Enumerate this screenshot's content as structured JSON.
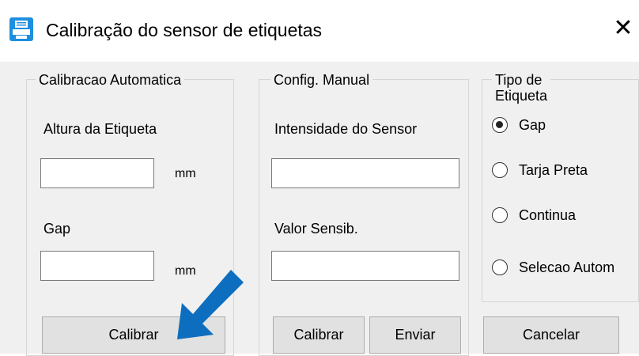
{
  "window": {
    "title": "Calibração do sensor de etiquetas",
    "app_icon": "printer-icon",
    "close_glyph": "✕",
    "accent_color": "#0f7fd0"
  },
  "auto_group": {
    "legend": "Calibracao Automatica",
    "height_label": "Altura da Etiqueta",
    "height_value": "",
    "height_unit": "mm",
    "gap_label": "Gap",
    "gap_value": "",
    "gap_unit": "mm",
    "calibrate_button": "Calibrar"
  },
  "manual_group": {
    "legend": "Config. Manual",
    "intensity_label": "Intensidade do Sensor",
    "intensity_value": "",
    "sensitivity_label": "Valor Sensib.",
    "sensitivity_value": "",
    "calibrate_button": "Calibrar",
    "send_button": "Enviar"
  },
  "type_group": {
    "legend_line1": "Tipo de",
    "legend_line2": "Etiqueta",
    "options": [
      {
        "label": "Gap",
        "checked": true
      },
      {
        "label": "Tarja Preta",
        "checked": false
      },
      {
        "label": "Continua",
        "checked": false
      },
      {
        "label": "Selecao Autom",
        "checked": false
      }
    ]
  },
  "cancel_button": "Cancelar",
  "overlay": {
    "arrow_icon": "pointer-arrow-icon",
    "arrow_color": "#0d6ebf"
  }
}
